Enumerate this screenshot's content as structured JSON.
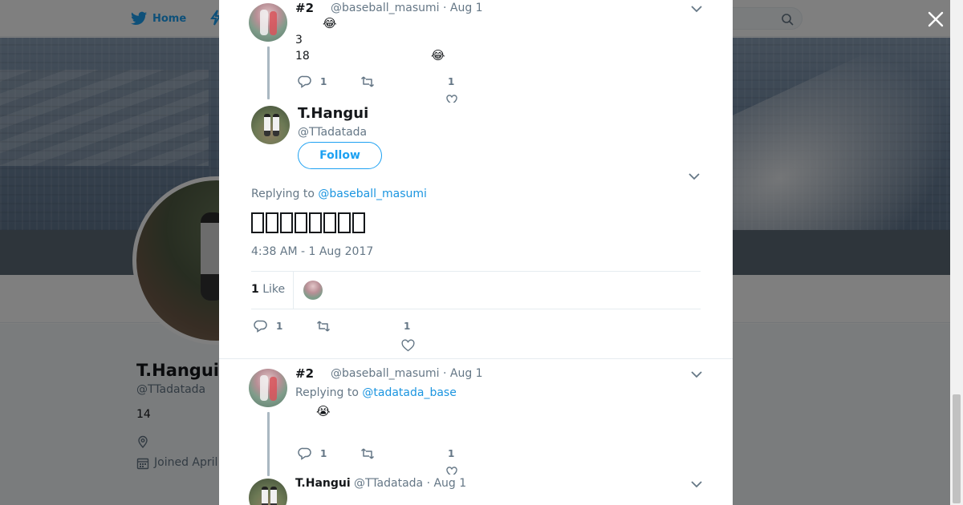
{
  "nav": {
    "home_label": "Home"
  },
  "profile": {
    "name": "T.Hangui",
    "handle": "@TTadatada",
    "bio": "14",
    "joined": "Joined April"
  },
  "tweet1": {
    "rank": "#2",
    "meta": "@baseball_masumi · Aug 1",
    "emoji": "😂",
    "line1": "3",
    "line2": "18",
    "line2_emoji": "😂",
    "reply_count": "1",
    "like_count": "1"
  },
  "main": {
    "name": "T.Hangui",
    "handle": "@TTadatada",
    "follow_label": "Follow",
    "replying_prefix": "Replying to",
    "replying_link": "@baseball_masumi",
    "timestamp": "4:38 AM - 1 Aug 2017",
    "likes_count": "1",
    "likes_label": "Like",
    "reply_count": "1",
    "like_count": "1"
  },
  "tweet3": {
    "rank": "#2",
    "meta": "@baseball_masumi · Aug 1",
    "replying_prefix": "Replying to",
    "replying_link": "@tadatada_base",
    "emoji": "😭",
    "reply_count": "1",
    "like_count": "1"
  },
  "tweet4": {
    "name": "T.Hangui",
    "meta": "@TTadatada · Aug 1"
  },
  "colors": {
    "accent": "#1da1f2",
    "link": "#1b95e0",
    "muted": "#657786"
  },
  "icons": [
    "twitter-bird-icon",
    "lightning-icon",
    "search-icon",
    "close-icon",
    "chevron-down-icon",
    "reply-icon",
    "retweet-icon",
    "heart-icon",
    "location-icon",
    "calendar-icon"
  ]
}
